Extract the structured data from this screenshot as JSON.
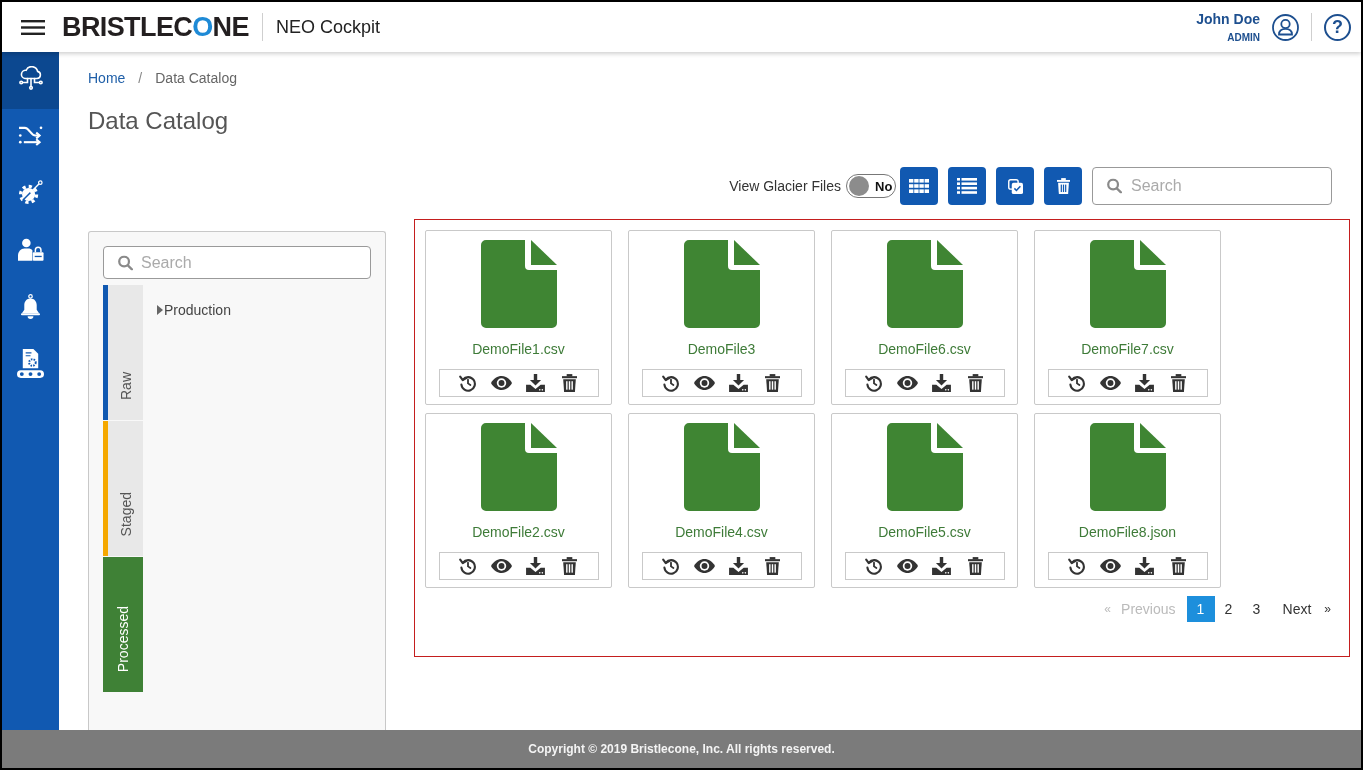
{
  "header": {
    "logo": [
      {
        "text": "BRISTLEC",
        "accent": false
      },
      {
        "text": "O",
        "accent": true
      },
      {
        "text": "NE",
        "accent": false
      }
    ],
    "app_name": "NEO Cockpit",
    "user": {
      "name": "John Doe",
      "role": "ADMIN"
    },
    "help": "?"
  },
  "sidebar": {
    "items": [
      {
        "selected": true
      },
      {
        "selected": false
      },
      {
        "selected": false
      },
      {
        "selected": false
      },
      {
        "selected": false
      },
      {
        "selected": false
      }
    ]
  },
  "breadcrumb": {
    "separator": "/",
    "items": [
      {
        "label": "Home",
        "current": false
      },
      {
        "label": "Data Catalog",
        "current": true
      }
    ]
  },
  "title": "Data Catalog",
  "toolbar": {
    "glacier_label": "View Glacier Files",
    "glacier_toggle": {
      "on": false,
      "text": "No"
    },
    "search": {
      "placeholder": "Search"
    }
  },
  "zones": {
    "search": {
      "placeholder": "Search"
    },
    "tabs": [
      {
        "label": "Raw",
        "selected": false,
        "color": "#1159b1"
      },
      {
        "label": "Staged",
        "selected": false,
        "color": "#f5a800"
      },
      {
        "label": "Processed",
        "selected": true,
        "color": "#3f8136"
      }
    ],
    "tree": [
      {
        "label": "Production",
        "expanded": false
      }
    ]
  },
  "files": {
    "items": [
      {
        "name": "DemoFile1.csv"
      },
      {
        "name": "DemoFile3"
      },
      {
        "name": "DemoFile6.csv"
      },
      {
        "name": "DemoFile7.csv"
      },
      {
        "name": "DemoFile2.csv"
      },
      {
        "name": "DemoFile4.csv"
      },
      {
        "name": "DemoFile5.csv"
      },
      {
        "name": "DemoFile8.json"
      }
    ]
  },
  "pagination": {
    "previous": {
      "arrow": "«",
      "label": "Previous",
      "disabled": true
    },
    "pages": [
      {
        "label": "1",
        "selected": true
      },
      {
        "label": "2",
        "selected": false
      },
      {
        "label": "3",
        "selected": false
      }
    ],
    "next": {
      "label": "Next",
      "arrow": "»",
      "disabled": false
    }
  },
  "footer": "Copyright © 2019 Bristlecone, Inc. All rights reserved."
}
